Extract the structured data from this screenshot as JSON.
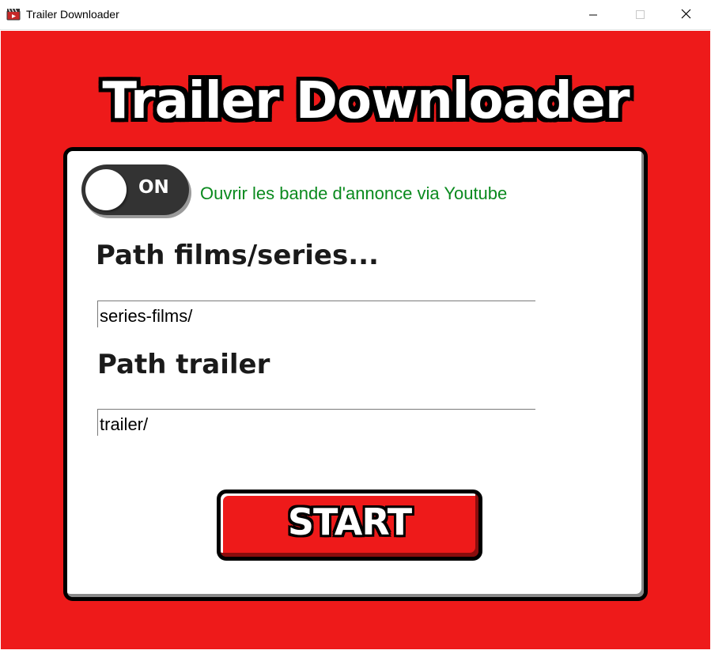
{
  "window": {
    "title": "Trailer Downloader",
    "icon": "film-clapper-icon"
  },
  "app": {
    "heading": "Trailer Downloader",
    "background_color": "#ee1a1a"
  },
  "youtube_toggle": {
    "state_label": "ON",
    "state": true,
    "description": "Ouvrir les bande d'annonce via Youtube",
    "description_color": "#0a8a1e"
  },
  "films_path": {
    "label": "Path films/series...",
    "value": "series-films/"
  },
  "trailer_path": {
    "label": "Path trailer",
    "value": "trailer/"
  },
  "start_button": {
    "label": "START"
  }
}
